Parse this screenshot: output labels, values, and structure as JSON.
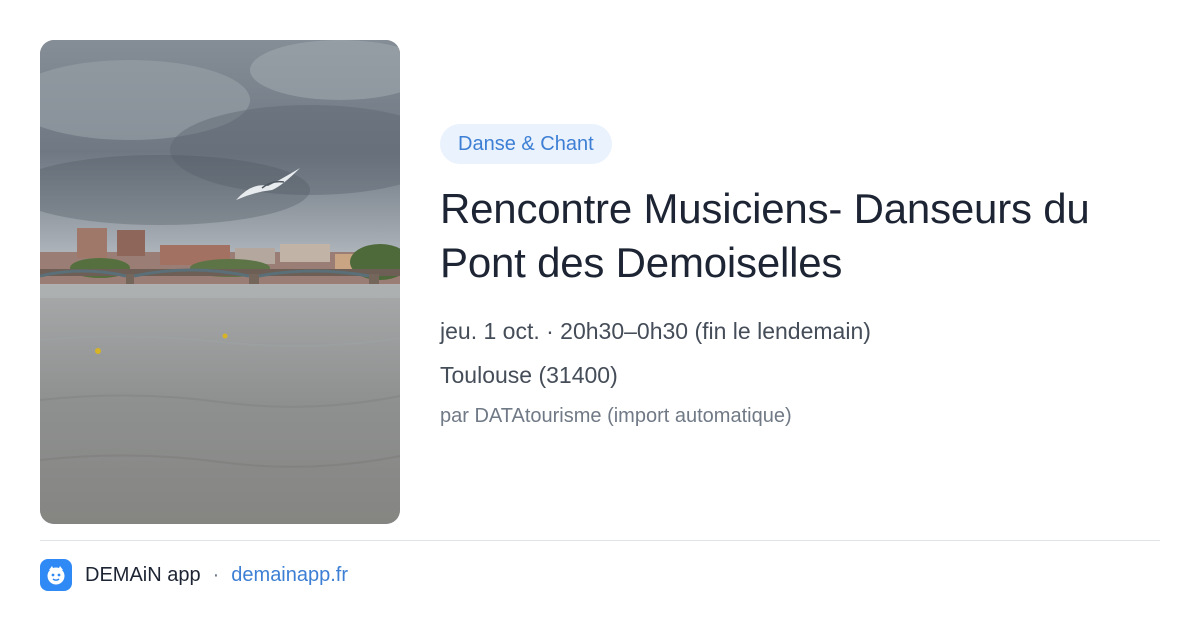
{
  "event": {
    "category": "Danse & Chant",
    "title": "Rencontre Musiciens- Danseurs du Pont des Demoiselles",
    "datetime": "jeu. 1 oct. · 20h30–0h30 (fin le lendemain)",
    "location": "Toulouse (31400)",
    "source": "par DATAtourisme (import automatique)"
  },
  "footer": {
    "app_name": "DEMAiN app",
    "separator": "·",
    "link_text": "demainapp.fr"
  },
  "icons": {
    "app_logo": "demain-app-logo-icon"
  },
  "colors": {
    "badge_bg": "#eaf2fd",
    "badge_text": "#3d7fd4",
    "title": "#1d2433",
    "link": "#3d7fd4",
    "logo_bg": "#2f8af5"
  }
}
